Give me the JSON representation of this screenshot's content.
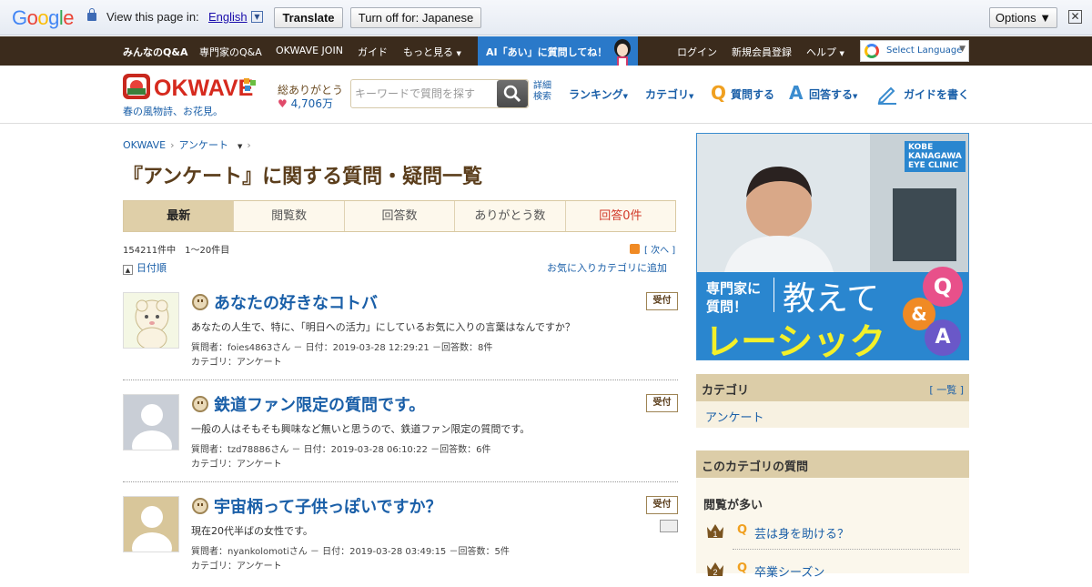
{
  "translate_bar": {
    "view_text": "View this page in:",
    "language": "English",
    "translate_label": "Translate",
    "turn_off_label": "Turn off for: Japanese",
    "options_label": "Options ▼",
    "close": "✕"
  },
  "topnav": {
    "items": [
      "みんなのQ&A",
      "専門家のQ&A",
      "OKWAVE JOIN",
      "ガイド",
      "もっと見る"
    ],
    "ai_text": "AI「あい」に質問してね！",
    "login": "ログイン",
    "register": "新規会員登録",
    "help": "ヘルプ",
    "select_language": "Select Language"
  },
  "header": {
    "logo_text": "OKWAVE",
    "logo_sub": "春の風物詩、お花見。",
    "thanks_label": "総ありがとう",
    "thanks_count": "4,706万",
    "search_placeholder": "キーワードで質問を探す",
    "advanced_1": "詳細",
    "advanced_2": "検索",
    "ranking": "ランキング",
    "category": "カテゴリ",
    "ask": "質問する",
    "answer": "回答する",
    "guide": "ガイドを書く"
  },
  "breadcrumb": [
    "OKWAVE",
    "アンケート"
  ],
  "page_title": "『アンケート』に関する質問・疑問一覧",
  "tabs": [
    "最新",
    "閲覧数",
    "回答数",
    "ありがとう数",
    "回答0件"
  ],
  "list_info": {
    "count": "154211件中　1～20件目",
    "next": "[ 次へ ]",
    "sort": "日付順",
    "favorite": "お気に入りカテゴリに追加"
  },
  "questions": [
    {
      "title": "あなたの好きなコトバ",
      "body": "あなたの人生で、特に、「明日への活力」にしているお気に入りの言葉はなんですか？",
      "meta": "質問者：foies4863さん － 日付：2019-03-28 12:29:21 －回答数：8件",
      "category": "カテゴリ：アンケート",
      "badge": "受付"
    },
    {
      "title": "鉄道ファン限定の質問です。",
      "body": "一般の人はそもそも興味など無いと思うので、鉄道ファン限定の質問です。",
      "meta": "質問者：tzd78886さん － 日付：2019-03-28 06:10:22 －回答数：6件",
      "category": "カテゴリ：アンケート",
      "badge": "受付"
    },
    {
      "title": "宇宙柄って子供っぽいですか？",
      "body": "現在20代半ばの女性です。",
      "meta": "質問者：nyankolomotiさん － 日付：2019-03-28 03:49:15 －回答数：5件",
      "category": "カテゴリ：アンケート",
      "badge": "受付"
    }
  ],
  "ad": {
    "clinic_line1": "KOBE",
    "clinic_line2": "KANAGAWA",
    "clinic_line3": "EYE CLINIC",
    "expert_line1": "専門家に",
    "expert_line2": "質問！",
    "headline1": "教えて",
    "headline2": "レーシック",
    "q": "Q",
    "and": "&",
    "a": "A"
  },
  "sidebar": {
    "category_header": "カテゴリ",
    "category_link": "[ 一覧 ]",
    "category_item": "アンケート",
    "this_cat_header": "このカテゴリの質問",
    "most_viewed": "閲覧が多い",
    "ranks": [
      {
        "q": "Q",
        "title": "芸は身を助ける？",
        "rank": "1"
      },
      {
        "q": "Q",
        "title": "卒業シーズン",
        "rank": "2"
      }
    ]
  },
  "colors": {
    "nav_bg": "#3b2b1c",
    "ai_bg": "#2a79c9",
    "link": "#1a5fa8",
    "title_brown": "#5b3e1c",
    "tab_active": "#dfcfa8",
    "panel": "#dccda8"
  }
}
